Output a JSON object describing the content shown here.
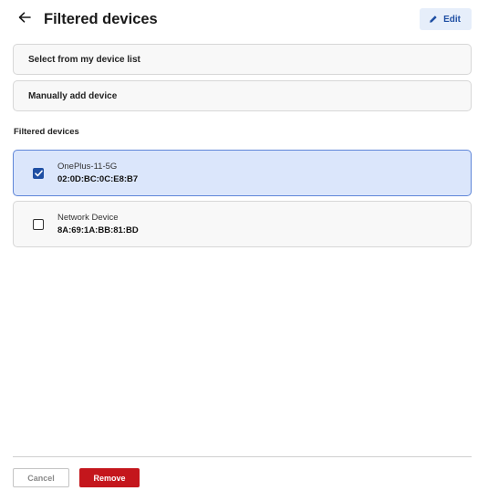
{
  "header": {
    "title": "Filtered devices",
    "edit_label": "Edit",
    "back_icon": "arrow-left-icon",
    "edit_icon": "pencil-icon"
  },
  "options": {
    "select_from_list": "Select from my device list",
    "manually_add": "Manually add device"
  },
  "filtered": {
    "section_label": "Filtered devices",
    "devices": [
      {
        "name": "OnePlus-11-5G",
        "mac": "02:0D:BC:0C:E8:B7",
        "checked": true
      },
      {
        "name": "Network Device",
        "mac": "8A:69:1A:BB:81:BD",
        "checked": false
      }
    ]
  },
  "footer": {
    "cancel_label": "Cancel",
    "remove_label": "Remove"
  },
  "colors": {
    "accent": "#1f4fa3",
    "selected_bg": "#dbe6fb",
    "danger": "#c4161c"
  }
}
